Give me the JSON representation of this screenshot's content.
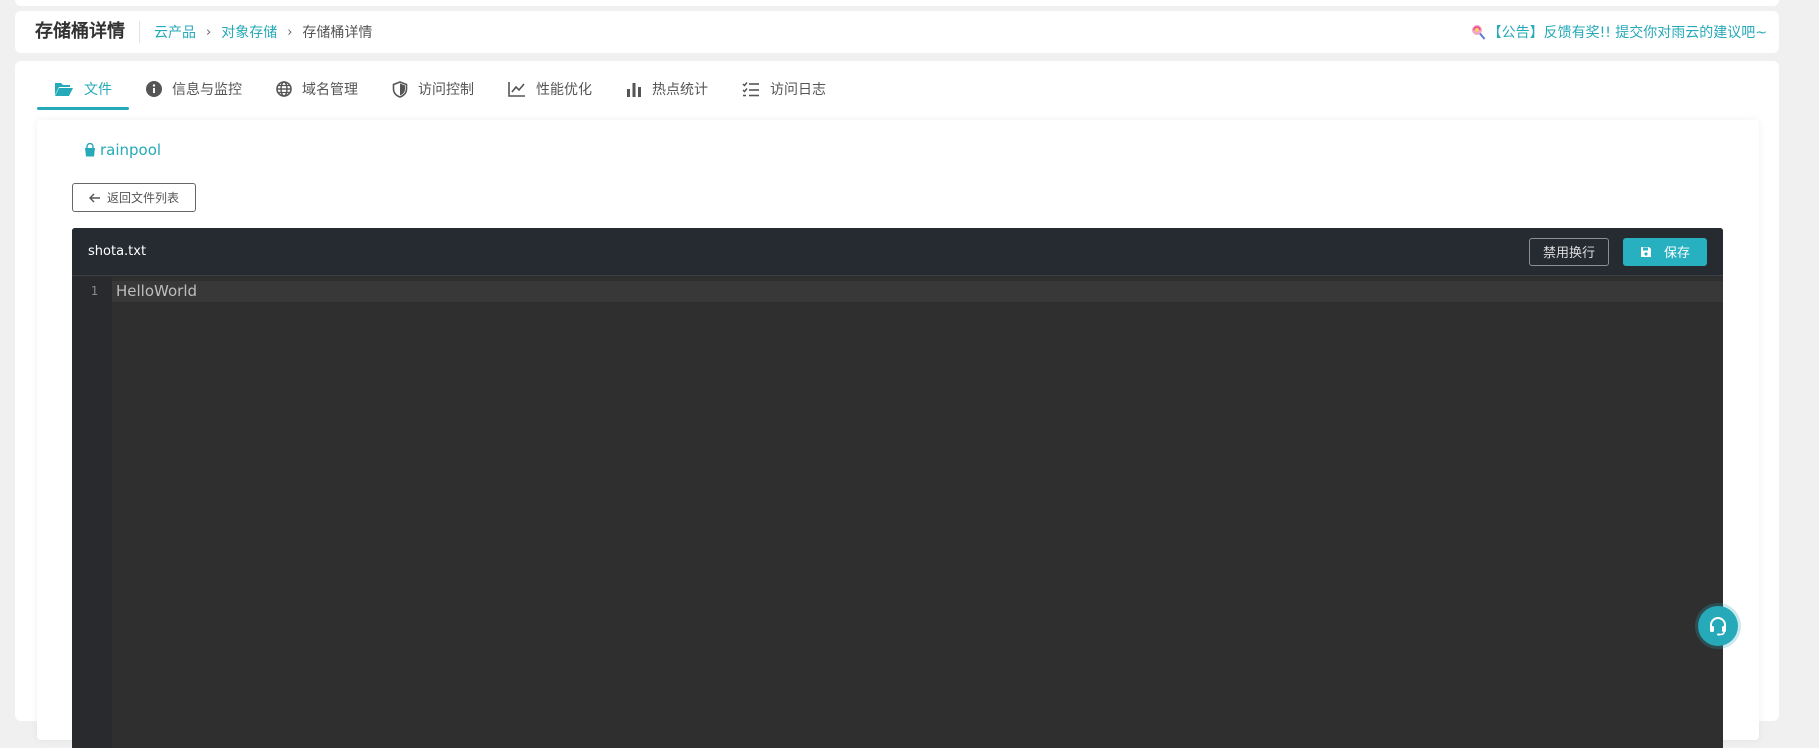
{
  "header": {
    "title": "存储桶详情",
    "breadcrumb": {
      "items": [
        "云产品",
        "对象存储"
      ],
      "current": "存储桶详情"
    },
    "announcement": "【公告】反馈有奖!! 提交你对雨云的建议吧~"
  },
  "tabs": [
    {
      "label": "文件",
      "icon": "folder-open-icon",
      "active": true
    },
    {
      "label": "信息与监控",
      "icon": "info-circle-icon",
      "active": false
    },
    {
      "label": "域名管理",
      "icon": "globe-icon",
      "active": false
    },
    {
      "label": "访问控制",
      "icon": "shield-icon",
      "active": false
    },
    {
      "label": "性能优化",
      "icon": "line-chart-icon",
      "active": false
    },
    {
      "label": "热点统计",
      "icon": "bar-chart-icon",
      "active": false
    },
    {
      "label": "访问日志",
      "icon": "checklist-icon",
      "active": false
    }
  ],
  "bucket": {
    "name": "rainpool",
    "icon": "bucket-icon"
  },
  "back_button": {
    "label": "返回文件列表",
    "icon": "arrow-left-icon"
  },
  "editor": {
    "file_name": "shota.txt",
    "wrap_button": "禁用换行",
    "save_button": "保存",
    "lines": [
      {
        "number": "1",
        "text": "HelloWorld"
      }
    ]
  },
  "support": {
    "icon": "headset-icon"
  },
  "colors": {
    "accent": "#26a9b8",
    "editor_bg": "#2f2f2f",
    "editor_header_bg": "#262b31",
    "page_bg": "#f0f0f0"
  }
}
